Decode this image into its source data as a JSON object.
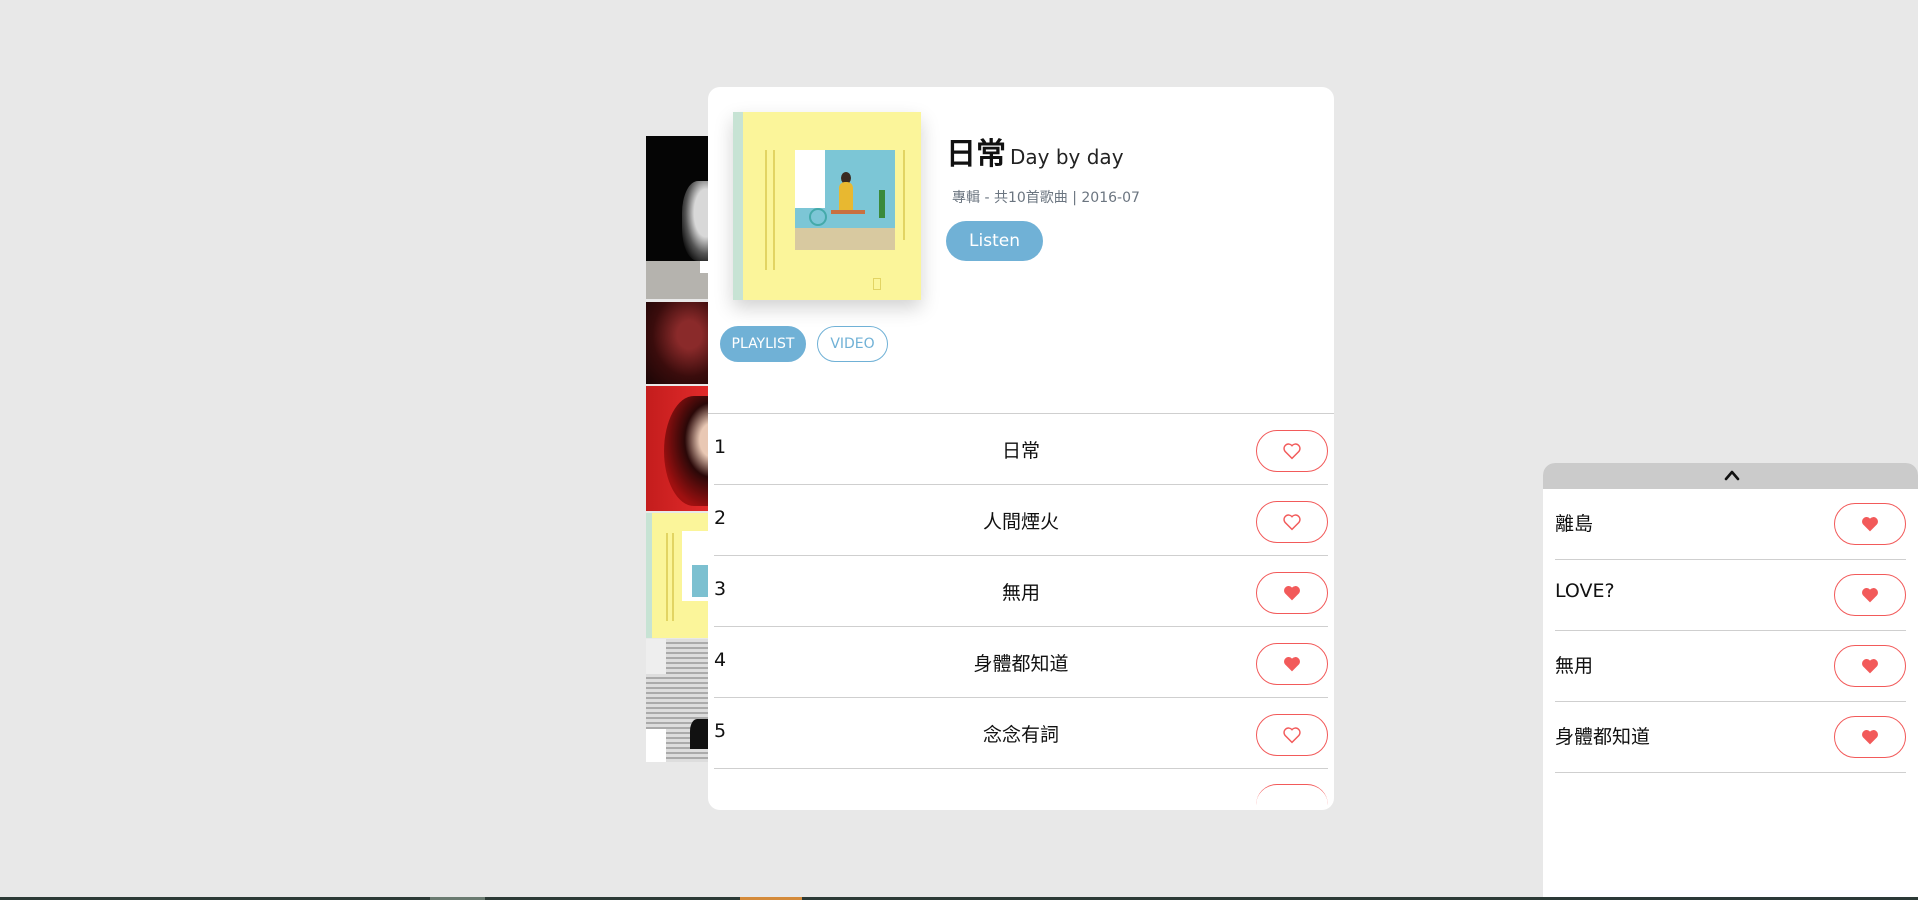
{
  "album": {
    "title": "日常",
    "subtitle": "Day by day",
    "meta": "專輯 - 共10首歌曲 | 2016-07",
    "listen_label": "Listen"
  },
  "tabs": [
    {
      "label": "PLAYLIST",
      "active": true
    },
    {
      "label": "VIDEO",
      "active": false
    }
  ],
  "tracks": [
    {
      "num": "1",
      "name": "日常",
      "liked": false
    },
    {
      "num": "2",
      "name": "人間煙火",
      "liked": false
    },
    {
      "num": "3",
      "name": "無用",
      "liked": true
    },
    {
      "num": "4",
      "name": "身體都知道",
      "liked": true
    },
    {
      "num": "5",
      "name": "念念有詞",
      "liked": false
    }
  ],
  "favorites": [
    {
      "name": "離島"
    },
    {
      "name": "LOVE?"
    },
    {
      "name": "無用"
    },
    {
      "name": "身體都知道"
    }
  ],
  "colors": {
    "accent": "#70b1d6",
    "heart": "#f25a5a",
    "background": "#e8e8e8",
    "cover": "#fbf59a"
  },
  "icons": {
    "heart_outline": "heart-outline-icon",
    "heart_filled": "heart-filled-icon",
    "collapse": "chevron-up-icon"
  }
}
